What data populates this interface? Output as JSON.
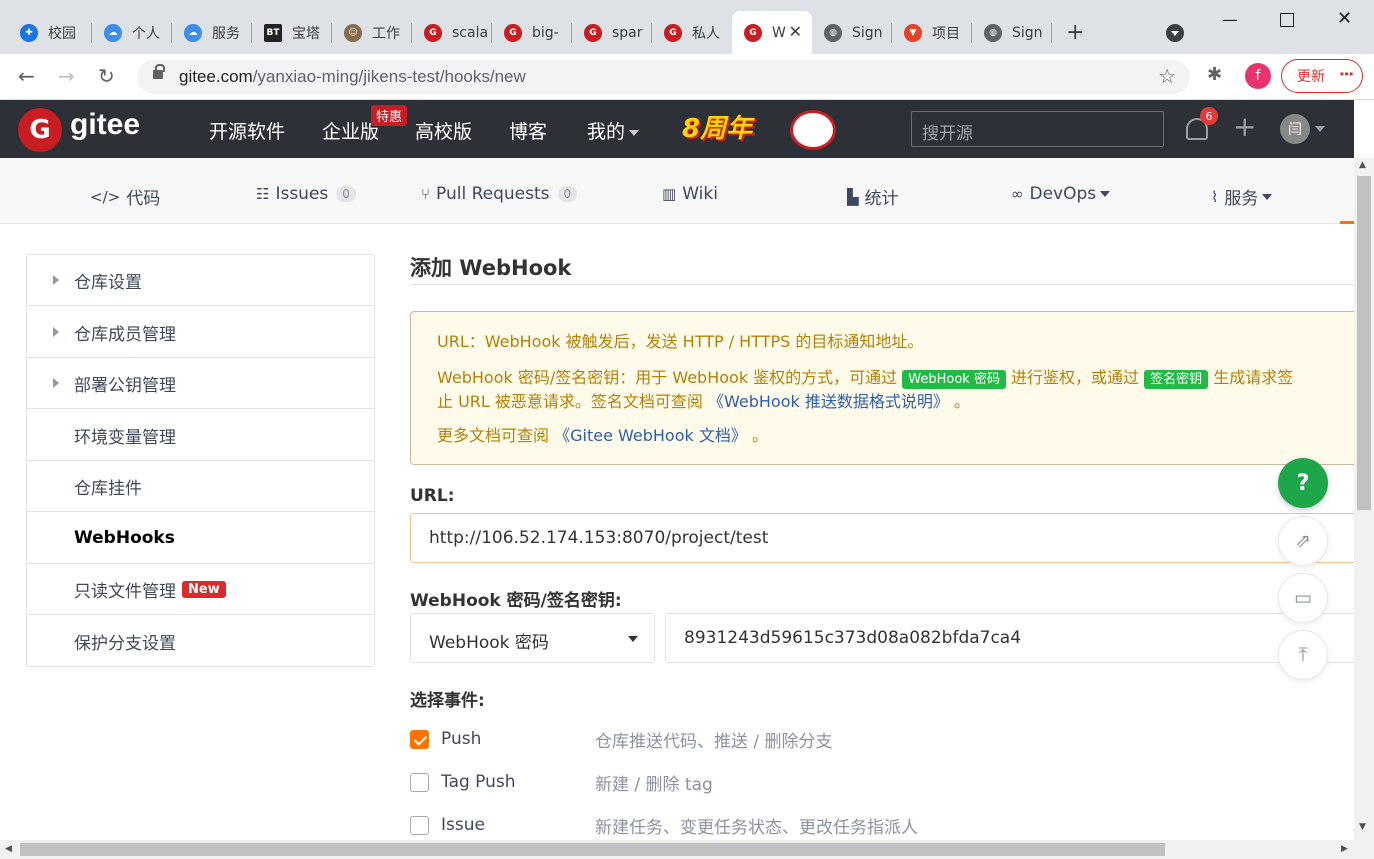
{
  "browser": {
    "tabs": [
      {
        "label": "校园",
        "icon": "network-icon",
        "color": "#1a73e8"
      },
      {
        "label": "个人",
        "icon": "cloud-icon",
        "color": "#3b8fe8"
      },
      {
        "label": "服务",
        "icon": "cloud-icon",
        "color": "#3b8fe8"
      },
      {
        "label": "宝塔",
        "icon": "bt-icon",
        "color": "#202124"
      },
      {
        "label": "工作",
        "icon": "avatar-icon",
        "color": "#8a6a4a"
      },
      {
        "label": "scala",
        "icon": "gitee-icon",
        "color": "#c71d23"
      },
      {
        "label": "big-",
        "icon": "gitee-icon",
        "color": "#c71d23"
      },
      {
        "label": "spar",
        "icon": "gitee-icon",
        "color": "#c71d23"
      },
      {
        "label": "私人",
        "icon": "gitee-icon",
        "color": "#c71d23"
      },
      {
        "label": "W",
        "icon": "gitee-icon",
        "color": "#c71d23"
      },
      {
        "label": "Sign",
        "icon": "globe-icon",
        "color": "#5f6368"
      },
      {
        "label": "项目",
        "icon": "gitlab-icon",
        "color": "#e24329"
      },
      {
        "label": "Sign",
        "icon": "globe-icon",
        "color": "#5f6368"
      }
    ],
    "new_tab": "+",
    "url_host": "gitee.com",
    "url_path": "/yanxiao-ming/jikens-test/hooks/new",
    "profile_letter": "f",
    "update_label": "更新"
  },
  "header": {
    "logo_letter": "G",
    "brand": "gitee",
    "nav": [
      "开源软件",
      "企业版",
      "高校版",
      "博客",
      "我的"
    ],
    "tehui": "特惠",
    "banner": "8周年",
    "search_placeholder": "搜开源",
    "notify_count": "6",
    "user_initial": "闫"
  },
  "repo_tabs": [
    {
      "label": "代码",
      "icon": "code-icon"
    },
    {
      "label": "Issues",
      "icon": "issues-icon",
      "count": "0"
    },
    {
      "label": "Pull Requests",
      "icon": "pull-request-icon",
      "count": "0"
    },
    {
      "label": "Wiki",
      "icon": "book-icon"
    },
    {
      "label": "统计",
      "icon": "bar-chart-icon"
    },
    {
      "label": "DevOps",
      "icon": "infinity-icon"
    },
    {
      "label": "服务",
      "icon": "pulse-icon"
    }
  ],
  "sidebar": {
    "items": [
      {
        "label": "仓库设置",
        "expandable": true
      },
      {
        "label": "仓库成员管理",
        "expandable": true
      },
      {
        "label": "部署公钥管理",
        "expandable": true
      },
      {
        "label": "环境变量管理",
        "expandable": false
      },
      {
        "label": "仓库挂件",
        "expandable": false
      },
      {
        "label": "WebHooks",
        "expandable": false,
        "active": true
      },
      {
        "label": "只读文件管理",
        "expandable": false,
        "badge": "New"
      },
      {
        "label": "保护分支设置",
        "expandable": false
      }
    ]
  },
  "main": {
    "title": "添加 WebHook",
    "notice": {
      "line1": "URL：WebHook 被触发后，发送 HTTP / HTTPS 的目标通知地址。",
      "line2_a": "WebHook 密码/签名密钥：用于 WebHook 鉴权的方式，可通过",
      "tag_password": "WebHook 密码",
      "line2_b": "进行鉴权，或通过",
      "tag_sign": "签名密钥",
      "line2_c": "生成请求签",
      "line3_a": "止 URL 被恶意请求。签名文档可查阅",
      "line3_link": "《WebHook 推送数据格式说明》",
      "line3_b": "。",
      "line4_a": "更多文档可查阅",
      "line4_link": "《Gitee WebHook 文档》",
      "line4_b": "。"
    },
    "url_label": "URL:",
    "url_value": "http://106.52.174.153:8070/project/test",
    "secret_label": "WebHook 密码/签名密钥:",
    "secret_type": "WebHook 密码",
    "secret_value": "8931243d59615c373d08a082bfda7ca4",
    "events_label": "选择事件:",
    "events": [
      {
        "name": "Push",
        "desc": "仓库推送代码、推送 / 删除分支",
        "checked": true
      },
      {
        "name": "Tag Push",
        "desc": "新建 / 删除 tag",
        "checked": false
      },
      {
        "name": "Issue",
        "desc": "新建任务、变更任务状态、更改任务指派人",
        "checked": false
      }
    ]
  },
  "float": {
    "help": "?"
  },
  "colors": {
    "accent": "#fe7300",
    "brand": "#c71d23",
    "green": "#21ba45"
  }
}
